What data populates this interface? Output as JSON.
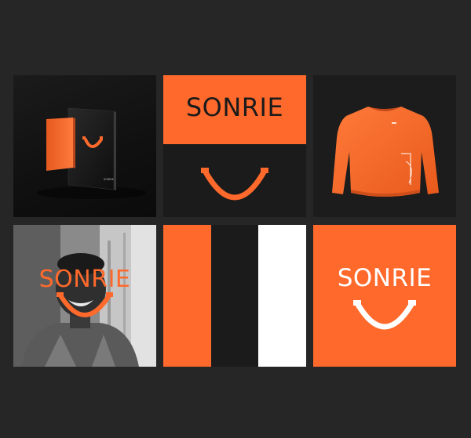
{
  "brand": {
    "wordmark": "SONRIE",
    "colors": {
      "orange": "#ff6a2c",
      "black": "#1b1b1b",
      "white": "#ffffff"
    }
  },
  "tiles": {
    "notebooks": {
      "cover_mark": "SONRIE"
    },
    "logo_lockup": {
      "wordmark": "SONRIE",
      "icon": "smile-icon"
    },
    "sweatshirt": {
      "icon": "sweatshirt-mockup"
    },
    "portrait": {
      "wordmark": "SONRIE",
      "icon": "smile-icon"
    },
    "palette": {
      "swatches": [
        "#ff6a2c",
        "#1b1b1b",
        "#ffffff"
      ]
    },
    "orange_logo": {
      "wordmark": "SONRIE",
      "icon": "smile-icon"
    }
  }
}
